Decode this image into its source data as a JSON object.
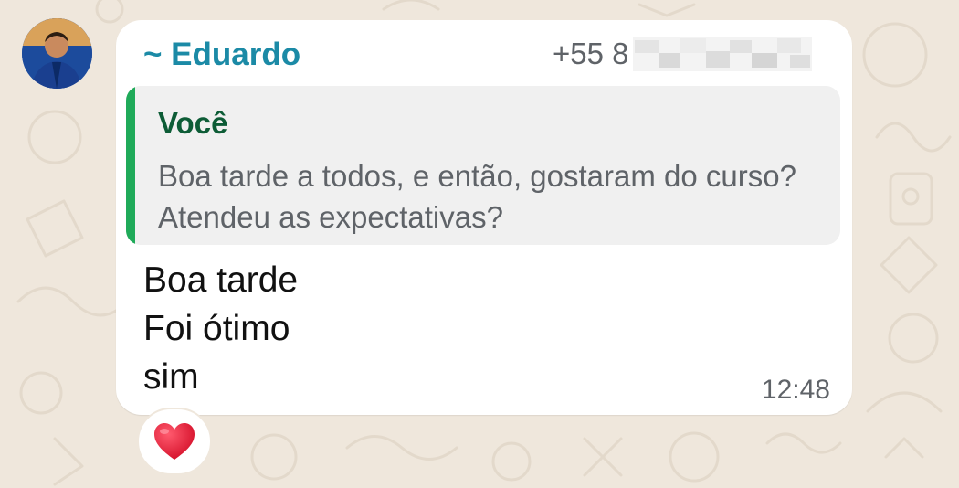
{
  "chat": {
    "sender_name": "~ Eduardo",
    "sender_phone_visible": "+55 8",
    "quoted_reply": {
      "author": "Você",
      "text": "Boa tarde a todos,  e então,  gostaram do curso? Atendeu as expectativas?"
    },
    "message_lines": [
      "Boa tarde",
      "Foi ótimo",
      "sim"
    ],
    "timestamp": "12:48",
    "reaction_icon": "red-heart-emoji"
  },
  "colors": {
    "background": "#efe7dc",
    "sender_name": "#1b8aa6",
    "quote_bar": "#1faa59",
    "quote_author": "#0d5c36",
    "reaction_heart": "#e0142c"
  }
}
